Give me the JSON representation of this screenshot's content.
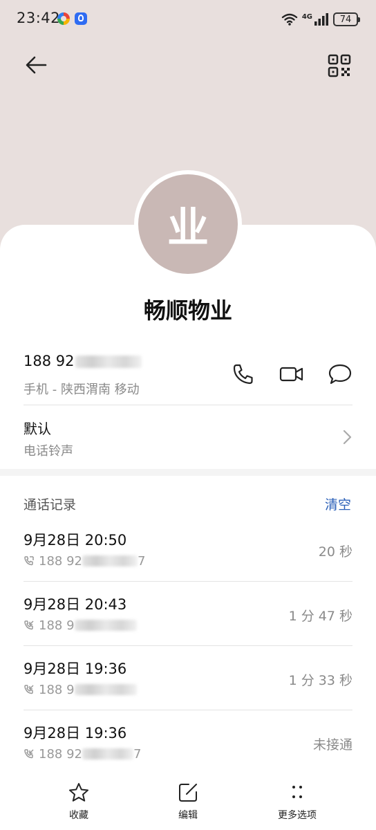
{
  "status_bar": {
    "time": "23:42",
    "network": "4G",
    "battery": "74"
  },
  "contact": {
    "avatar_text": "业",
    "name": "畅顺物业"
  },
  "phone": {
    "number_visible": "188 92",
    "type": "手机",
    "separator": " - ",
    "location": "陕西渭南 移动"
  },
  "ringtone": {
    "title": "默认",
    "subtitle": "电话铃声"
  },
  "call_log": {
    "title": "通话记录",
    "clear_label": "清空",
    "items": [
      {
        "time": "9月28日 20:50",
        "number_prefix": "188 92",
        "number_suffix": "7",
        "duration": "20 秒"
      },
      {
        "time": "9月28日 20:43",
        "number_prefix": "188 9",
        "number_suffix": "",
        "duration": "1 分 47 秒"
      },
      {
        "time": "9月28日 19:36",
        "number_prefix": "188 9",
        "number_suffix": "",
        "duration": "1 分 33 秒"
      },
      {
        "time": "9月28日 19:36",
        "number_prefix": "188 92",
        "number_suffix": "7",
        "duration": "未接通"
      }
    ]
  },
  "bottom_bar": {
    "favorite_label": "收藏",
    "edit_label": "编辑",
    "more_label": "更多选项"
  },
  "colors": {
    "header_bg": "#e8dfdd",
    "avatar_bg": "#c9b8b5",
    "accent": "#2a5fb8"
  }
}
